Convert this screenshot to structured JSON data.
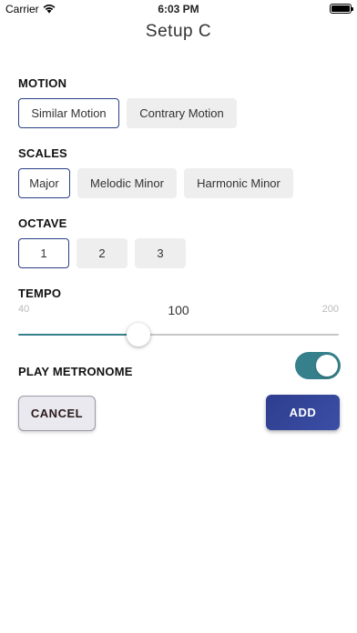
{
  "status_bar": {
    "carrier": "Carrier",
    "time": "6:03 PM"
  },
  "title": "Setup C",
  "motion": {
    "label": "MOTION",
    "options": [
      "Similar Motion",
      "Contrary Motion"
    ],
    "selected": "Similar Motion"
  },
  "scales": {
    "label": "SCALES",
    "options": [
      "Major",
      "Melodic Minor",
      "Harmonic Minor"
    ],
    "selected": "Major"
  },
  "octave": {
    "label": "OCTAVE",
    "options": [
      "1",
      "2",
      "3"
    ],
    "selected": "1"
  },
  "tempo": {
    "label": "TEMPO",
    "min": 40,
    "max": 200,
    "value": 100,
    "min_label": "40",
    "max_label": "200",
    "value_label": "100"
  },
  "metronome": {
    "label": "PLAY METRONOME",
    "on": true
  },
  "buttons": {
    "cancel": "CANCEL",
    "add": "ADD"
  },
  "colors": {
    "accent": "#35808b",
    "selected_border": "#2a3f86",
    "add_button": "#33449a"
  }
}
